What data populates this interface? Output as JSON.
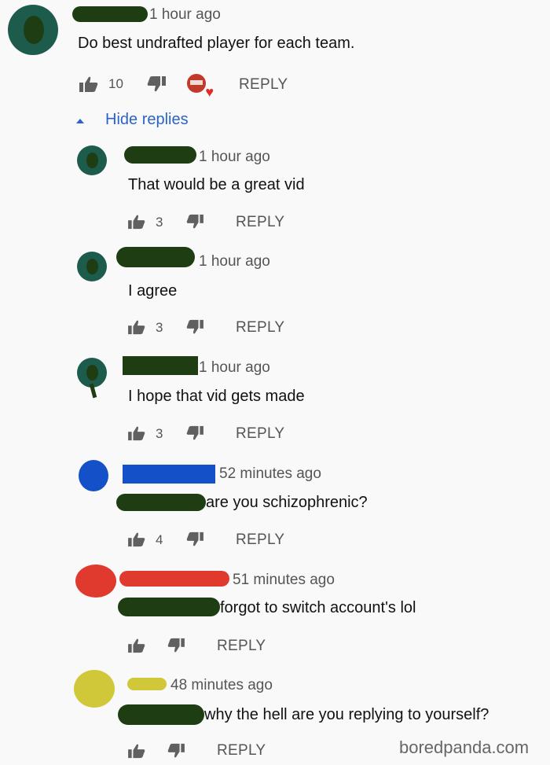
{
  "comment": {
    "timestamp": "1 hour ago",
    "text": "Do best undrafted player for each team.",
    "likes": "10",
    "reply_label": "REPLY",
    "avatar_color": "#1d5c4d",
    "name_color": "#1e3d12"
  },
  "hide_replies": {
    "label": "Hide replies",
    "color": "#2a64c8",
    "icon": "caret-up-icon"
  },
  "replies": [
    {
      "timestamp": "1 hour ago",
      "text": "That would be a great vid",
      "likes": "3",
      "reply_label": "REPLY",
      "avatar_color": "#1d5c4d",
      "name_color": "#1e3d12"
    },
    {
      "timestamp": "1 hour ago",
      "text": "I agree",
      "likes": "3",
      "reply_label": "REPLY",
      "avatar_color": "#1d5c4d",
      "name_color": "#1e3d12"
    },
    {
      "timestamp": "1 hour ago",
      "text": "I hope that vid gets made",
      "likes": "3",
      "reply_label": "REPLY",
      "avatar_color": "#1d5c4d",
      "name_color": "#1e3d12"
    },
    {
      "timestamp": "52 minutes ago",
      "text": "are you schizophrenic?",
      "likes": "4",
      "reply_label": "REPLY",
      "avatar_color": "#1450c8",
      "name_color": "#1450c8"
    },
    {
      "timestamp": "51 minutes ago",
      "text": "forgot to switch account's lol",
      "likes": "",
      "reply_label": "REPLY",
      "avatar_color": "#e03a2e",
      "name_color": "#e03a2e"
    },
    {
      "timestamp": "48 minutes ago",
      "text": "why the hell are you replying to yourself?",
      "likes": "",
      "reply_label": "REPLY",
      "avatar_color": "#d0c838",
      "name_color": "#d0c838"
    }
  ],
  "icons": {
    "like": "thumbs-up-icon",
    "dislike": "thumbs-down-icon",
    "creator_heart": "creator-heart-icon"
  },
  "watermark": "boredpanda.com"
}
